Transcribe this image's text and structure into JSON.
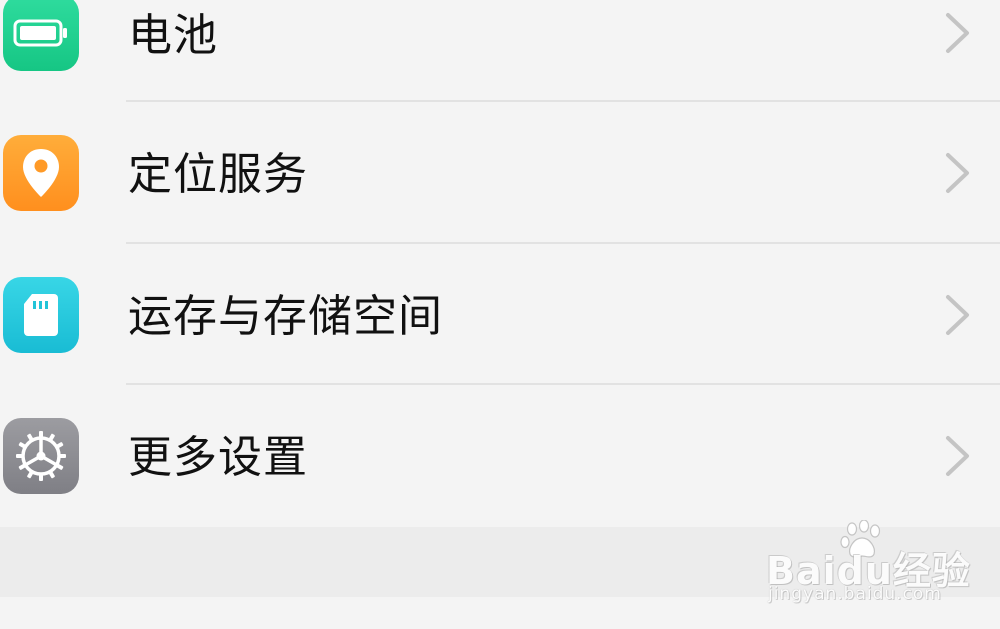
{
  "settings_list": {
    "items": [
      {
        "label": "电池",
        "icon": "battery-icon",
        "color": "#1fcf8f"
      },
      {
        "label": "定位服务",
        "icon": "location-pin-icon",
        "color": "#ff9d2a"
      },
      {
        "label": "运存与存储空间",
        "icon": "sd-card-icon",
        "color": "#22c6d8"
      },
      {
        "label": "更多设置",
        "icon": "gear-icon",
        "color": "#8e8e93"
      }
    ]
  },
  "watermark": {
    "brand": "Baidu经验",
    "url": "jingyan.baidu.com"
  }
}
